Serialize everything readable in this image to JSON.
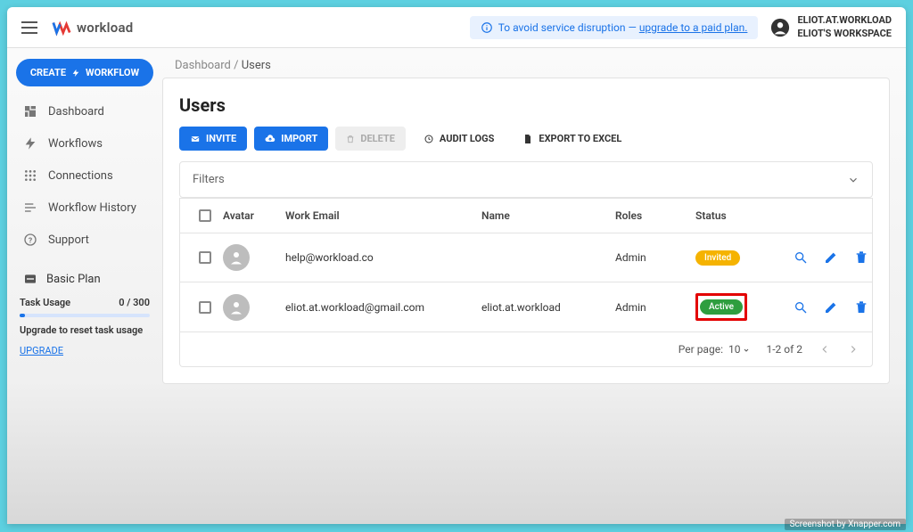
{
  "topbar": {
    "brand": "workload",
    "banner_prefix": "To avoid service disruption — ",
    "banner_link": "upgrade to a paid plan.",
    "user_line1": "ELIOT.AT.WORKLOAD",
    "user_line2": "ELIOT'S WORKSPACE"
  },
  "sidebar": {
    "create_label": "CREATE",
    "workflow_label": "WORKFLOW",
    "items": [
      {
        "label": "Dashboard"
      },
      {
        "label": "Workflows"
      },
      {
        "label": "Connections"
      },
      {
        "label": "Workflow History"
      },
      {
        "label": "Support"
      }
    ],
    "plan": {
      "title": "Basic Plan",
      "usage_label": "Task Usage",
      "usage_value": "0 / 300",
      "reset_text": "Upgrade to reset task usage",
      "upgrade_link": "UPGRADE"
    }
  },
  "breadcrumb": {
    "root": "Dashboard",
    "sep": "/",
    "current": "Users"
  },
  "main": {
    "title": "Users",
    "toolbar": {
      "invite": "INVITE",
      "import": "IMPORT",
      "delete": "DELETE",
      "audit": "AUDIT LOGS",
      "export": "EXPORT TO EXCEL"
    },
    "filters_label": "Filters",
    "columns": {
      "avatar": "Avatar",
      "email": "Work Email",
      "name": "Name",
      "roles": "Roles",
      "status": "Status"
    },
    "rows": [
      {
        "email": "help@workload.co",
        "name": "",
        "role": "Admin",
        "status": "Invited",
        "status_class": "invited",
        "highlight": false
      },
      {
        "email": "eliot.at.workload@gmail.com",
        "name": "eliot.at.workload",
        "role": "Admin",
        "status": "Active",
        "status_class": "active",
        "highlight": true
      }
    ],
    "pager": {
      "per_page_label": "Per page:",
      "per_page_value": "10",
      "range": "1-2 of 2"
    }
  },
  "footer": {
    "note": "Screenshot by Xnapper.com"
  }
}
